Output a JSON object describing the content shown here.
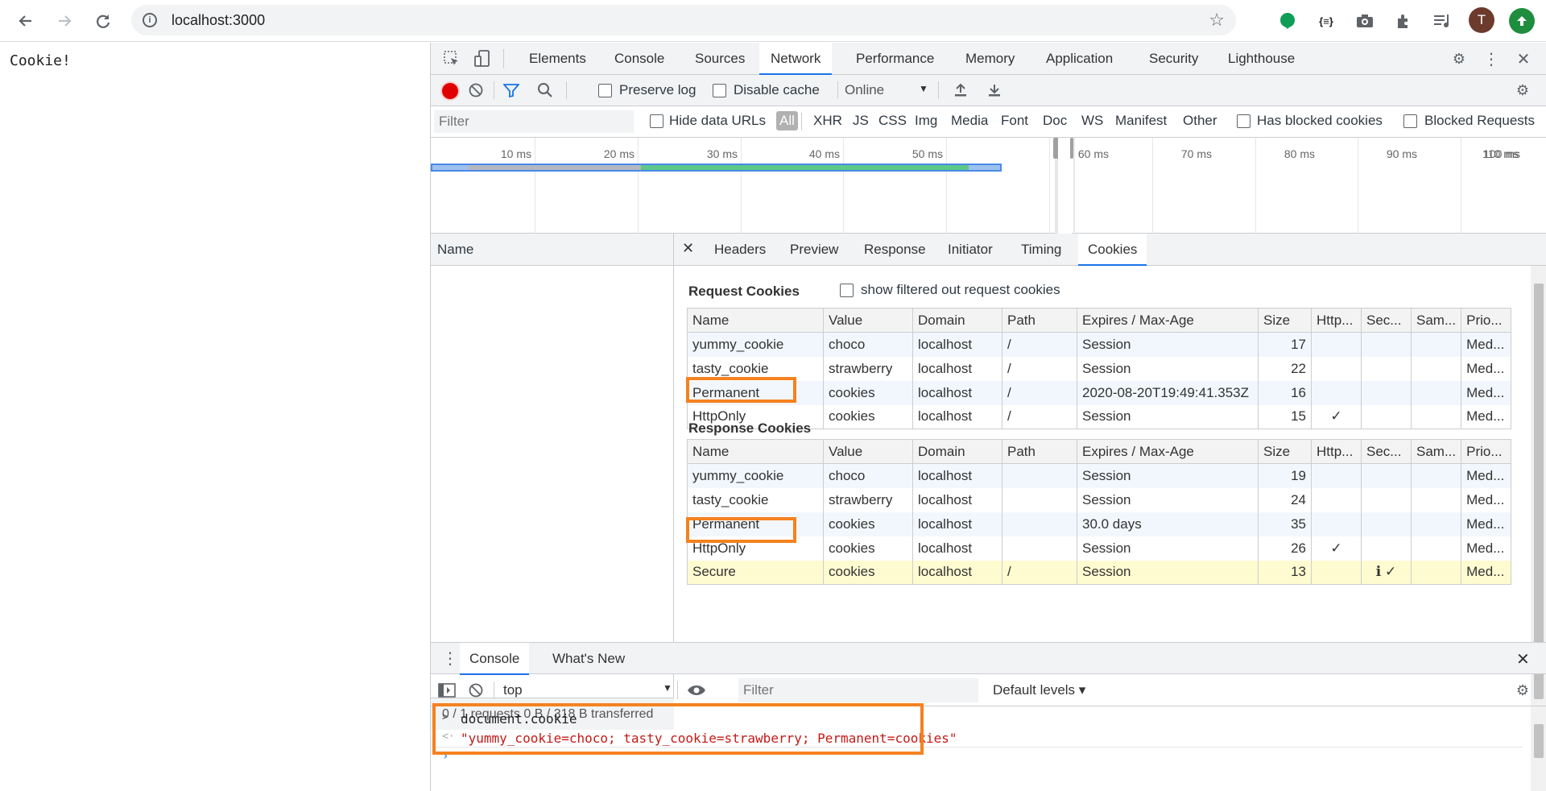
{
  "browser": {
    "url": "localhost:3000",
    "profile_initial": "T",
    "ext_json_label": "{≡}"
  },
  "page": {
    "text": "Cookie!"
  },
  "devtools": {
    "tabs": [
      "Elements",
      "Console",
      "Sources",
      "Network",
      "Performance",
      "Memory",
      "Application",
      "Security",
      "Lighthouse"
    ],
    "active_tab": "Network",
    "toolbar": {
      "preserve_log": "Preserve log",
      "disable_cache": "Disable cache",
      "throttle": "Online"
    },
    "filterbar": {
      "placeholder": "Filter",
      "hide_data_urls": "Hide data URLs",
      "types": [
        "All",
        "XHR",
        "JS",
        "CSS",
        "Img",
        "Media",
        "Font",
        "Doc",
        "WS",
        "Manifest",
        "Other"
      ],
      "has_blocked": "Has blocked cookies",
      "blocked_requests": "Blocked Requests"
    },
    "timeline_ticks": [
      "10 ms",
      "20 ms",
      "30 ms",
      "40 ms",
      "50 ms",
      "60 ms",
      "70 ms",
      "80 ms",
      "90 ms",
      "100 ms",
      "110 ms"
    ],
    "name_column": {
      "header": "Name",
      "footer": "0 / 1 requests    0 B / 318 B transferred"
    },
    "detail_tabs": [
      "Headers",
      "Preview",
      "Response",
      "Initiator",
      "Timing",
      "Cookies"
    ],
    "active_detail_tab": "Cookies",
    "request_cookies": {
      "title": "Request Cookies",
      "show_filtered": "show filtered out request cookies",
      "columns": [
        "Name",
        "Value",
        "Domain",
        "Path",
        "Expires / Max-Age",
        "Size",
        "Http...",
        "Sec...",
        "Sam...",
        "Prio..."
      ],
      "rows": [
        [
          "yummy_cookie",
          "choco",
          "localhost",
          "/",
          "Session",
          "17",
          "",
          "",
          "",
          "Med..."
        ],
        [
          "tasty_cookie",
          "strawberry",
          "localhost",
          "/",
          "Session",
          "22",
          "",
          "",
          "",
          "Med..."
        ],
        [
          "Permanent",
          "cookies",
          "localhost",
          "/",
          "2020-08-20T19:49:41.353Z",
          "16",
          "",
          "",
          "",
          "Med..."
        ],
        [
          "HttpOnly",
          "cookies",
          "localhost",
          "/",
          "Session",
          "15",
          "✓",
          "",
          "",
          "Med..."
        ]
      ]
    },
    "response_cookies": {
      "title": "Response Cookies",
      "columns": [
        "Name",
        "Value",
        "Domain",
        "Path",
        "Expires / Max-Age",
        "Size",
        "Http...",
        "Sec...",
        "Sam...",
        "Prio..."
      ],
      "rows": [
        [
          "yummy_cookie",
          "choco",
          "localhost",
          "",
          "Session",
          "19",
          "",
          "",
          "",
          "Med..."
        ],
        [
          "tasty_cookie",
          "strawberry",
          "localhost",
          "",
          "Session",
          "24",
          "",
          "",
          "",
          "Med..."
        ],
        [
          "Permanent",
          "cookies",
          "localhost",
          "",
          "30.0 days",
          "35",
          "",
          "",
          "",
          "Med..."
        ],
        [
          "HttpOnly",
          "cookies",
          "localhost",
          "",
          "Session",
          "26",
          "✓",
          "",
          "",
          "Med..."
        ],
        [
          "Secure",
          "cookies",
          "localhost",
          "/",
          "Session",
          "13",
          "",
          "ℹ ✓",
          "",
          "Med..."
        ]
      ]
    },
    "drawer": {
      "tabs": [
        "Console",
        "What's New"
      ],
      "context": "top",
      "filter_placeholder": "Filter",
      "levels": "Default levels ▾",
      "input": "document.cookie",
      "output": "\"yummy_cookie=choco; tasty_cookie=strawberry; Permanent=cookies\""
    }
  },
  "colors": {
    "highlight": "#f5821f",
    "accent": "#1a73e8",
    "record": "#e00000",
    "console_string": "#c41a16"
  }
}
